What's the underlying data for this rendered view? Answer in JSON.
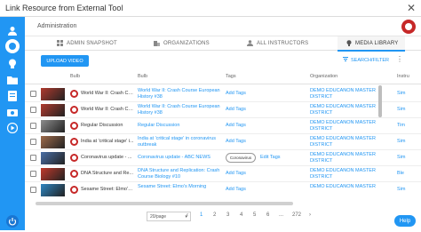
{
  "dialog": {
    "title": "Link Resource from External Tool",
    "close": "✕"
  },
  "header": {
    "breadcrumb": "Administration"
  },
  "tabs": [
    {
      "label": "ADMIN SNAPSHOT",
      "icon": "grid-icon"
    },
    {
      "label": "ORGANIZATIONS",
      "icon": "building-icon"
    },
    {
      "label": "ALL INSTRUCTORS",
      "icon": "person-icon"
    },
    {
      "label": "MEDIA LIBRARY",
      "icon": "bulb-icon",
      "active": true
    }
  ],
  "toolbar": {
    "upload_label": "UPLOAD VIDEO",
    "search_filter_label": "SEARCH/FILTER"
  },
  "table": {
    "headers": {
      "bulb1": "Bulb",
      "bulb2": "Bulb",
      "tags": "Tags",
      "organization": "Organization",
      "instructor": "Instru"
    },
    "rows": [
      {
        "bulb1": "World War II: Crash Co...",
        "bulb2": "World War II: Crash Course European History #38",
        "tags": "Add Tags",
        "org": "DEMO EDUCANON MASTER DISTRICT",
        "instr": "Sim",
        "thumb_color": "#b03a2e"
      },
      {
        "bulb1": "World War II: Crash Co...",
        "bulb2": "World War II: Crash Course European History #38",
        "tags": "Add Tags",
        "org": "DEMO EDUCANON MASTER DISTRICT",
        "instr": "Sim",
        "thumb_color": "#b03a2e"
      },
      {
        "bulb1": "Regular Discussion",
        "bulb2": "Regular Discussion",
        "tags": "Add Tags",
        "org": "DEMO EDUCANON MASTER DISTRICT",
        "instr": "Tim",
        "thumb_color": "#8d8d8d"
      },
      {
        "bulb1": "India at 'critical stage' i...",
        "bulb2": "India at 'critical stage' in coronavirus outbreak",
        "tags": "Add Tags",
        "org": "DEMO EDUCANON MASTER DISTRICT",
        "instr": "Sim",
        "thumb_color": "#9e6b4a"
      },
      {
        "bulb1": "Coronavirus update - ...",
        "bulb2": "Coronavirus update - ABC NEWS",
        "chip": "Coronavirus",
        "tags": "Edit Tags",
        "org": "DEMO EDUCANON MASTER DISTRICT",
        "instr": "Sim",
        "thumb_color": "#4a6fa5"
      },
      {
        "bulb1": "DNA Structure and Re...",
        "bulb2": "DNA Structure and Replication: Crash Course Biology #10",
        "tags": "Add Tags",
        "org": "DEMO EDUCANON MASTER DISTRICT",
        "instr": "Ble",
        "thumb_color": "#c0392b"
      },
      {
        "bulb1": "Sesame Street: Elmo's...",
        "bulb2": "Sesame Street: Elmo's Morning",
        "tags": "Add Tags",
        "org": "DEMO EDUCANON MASTER",
        "instr": "Sim",
        "thumb_color": "#2e86c1"
      }
    ]
  },
  "pagination": {
    "per_page": "20/page",
    "pages": [
      "1",
      "2",
      "3",
      "4",
      "5",
      "6",
      "...",
      "272"
    ],
    "current": "1",
    "prev": "‹",
    "next": "›"
  },
  "help_label": "Help",
  "colors": {
    "accent": "#2196f3",
    "brand_red": "#c62828"
  }
}
